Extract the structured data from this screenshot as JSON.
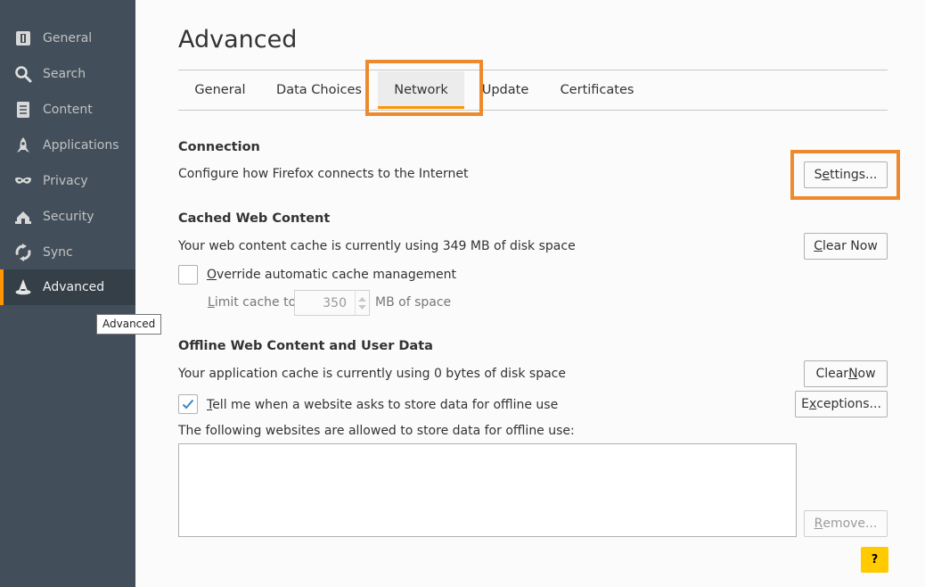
{
  "sidebar": {
    "items": [
      {
        "label": "General",
        "icon": "general-icon"
      },
      {
        "label": "Search",
        "icon": "search-icon"
      },
      {
        "label": "Content",
        "icon": "content-icon"
      },
      {
        "label": "Applications",
        "icon": "applications-icon"
      },
      {
        "label": "Privacy",
        "icon": "privacy-mask-icon"
      },
      {
        "label": "Security",
        "icon": "security-icon"
      },
      {
        "label": "Sync",
        "icon": "sync-icon"
      },
      {
        "label": "Advanced",
        "icon": "advanced-wizard-hat-icon"
      }
    ],
    "active": "Advanced",
    "tooltip": "Advanced"
  },
  "page": {
    "title": "Advanced"
  },
  "tabs": {
    "items": [
      "General",
      "Data Choices",
      "Network",
      "Update",
      "Certificates"
    ],
    "selected": "Network"
  },
  "connection": {
    "heading": "Connection",
    "description": "Configure how Firefox connects to the Internet",
    "settings_button": {
      "pre": "S",
      "accel": "e",
      "post": "ttings..."
    }
  },
  "cache": {
    "heading": "Cached Web Content",
    "description": "Your web content cache is currently using 349 MB of disk space",
    "clear_button": {
      "pre": "",
      "accel": "C",
      "post": "lear Now"
    },
    "override": {
      "pre": "",
      "accel": "O",
      "post": "verride automatic cache management",
      "checked": false
    },
    "limit_label": {
      "pre": "",
      "accel": "L",
      "post": "imit cache to"
    },
    "limit_value": "350",
    "limit_unit": "MB of space"
  },
  "offline": {
    "heading": "Offline Web Content and User Data",
    "description": "Your application cache is currently using 0 bytes of disk space",
    "clear_button": {
      "pre": "Clear ",
      "accel": "N",
      "post": "ow"
    },
    "tell_me": {
      "pre": "",
      "accel": "T",
      "post": "ell me when a website asks to store data for offline use",
      "checked": true
    },
    "exceptions_button": {
      "pre": "E",
      "accel": "x",
      "post": "ceptions..."
    },
    "allowed_label": "The following websites are allowed to store data for offline use:",
    "remove_button": {
      "pre": "",
      "accel": "R",
      "post": "emove..."
    }
  },
  "help": {
    "label": "?"
  },
  "colors": {
    "sidebar_bg": "#424f5a",
    "sidebar_active_bg": "#343f48",
    "accent": "#ff9500",
    "highlight": "#ee8a2e",
    "help_bg": "#ffcb00",
    "checkmark": "#3a86c4"
  }
}
